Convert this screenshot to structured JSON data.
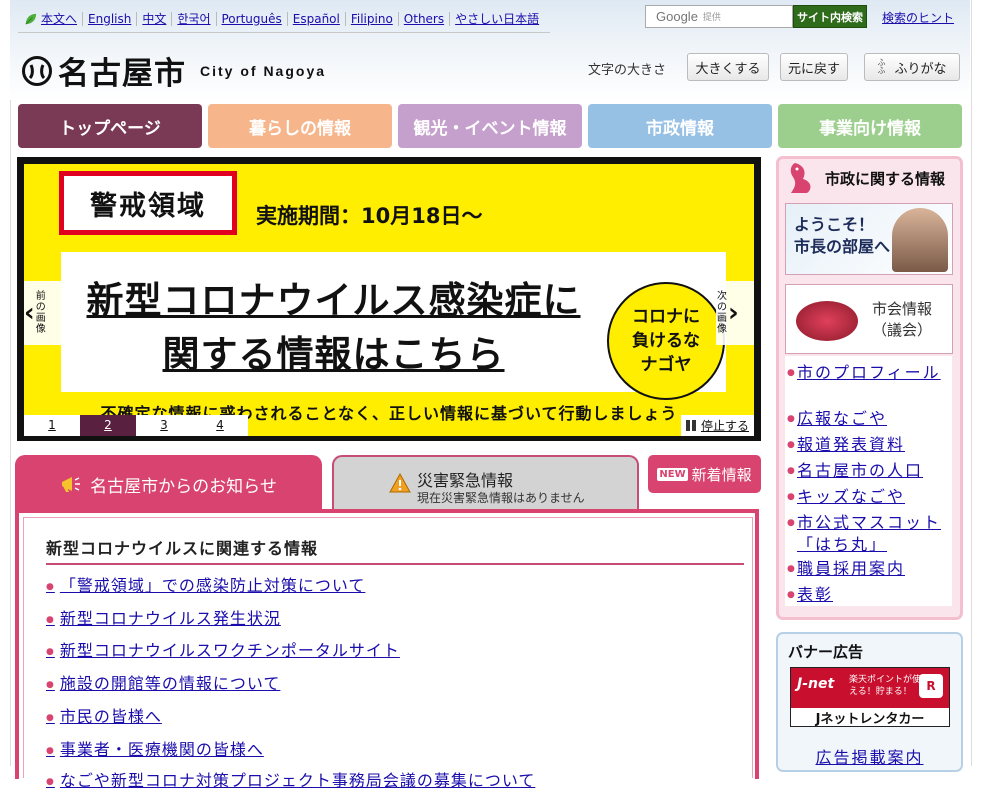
{
  "header": {
    "lang_links": [
      "本文へ",
      "English",
      "中文",
      "한국어",
      "Português",
      "Español",
      "Filipino",
      "Others",
      "やさしい日本語"
    ],
    "search": {
      "brand": "Google",
      "provided": "提供",
      "button_label": "サイト内検索",
      "hint_label": "検索のヒント"
    },
    "logo": {
      "name": "名古屋市",
      "sub": "City of Nagoya"
    },
    "text_size": {
      "label": "文字の大きさ",
      "larger": "大きくする",
      "reset": "元に戻す"
    },
    "furigana": {
      "ruby": "ふりがな"
    }
  },
  "nav": {
    "items": [
      {
        "label": "トップページ",
        "color": "#7a3a55"
      },
      {
        "label": "暮らしの情報",
        "color": "#f6b58a"
      },
      {
        "label": "観光・イベント情報",
        "color": "#c6a0cc"
      },
      {
        "label": "市政情報",
        "color": "#97c0e5"
      },
      {
        "label": "事業向け情報",
        "color": "#9ccf8e"
      }
    ]
  },
  "slideshow": {
    "badge": "警戒領域",
    "period": "実施期間：10月18日～",
    "headline_1": "新型コロナウイルス感染症に",
    "headline_2": "関する情報はこちら",
    "circle_text": "コロナに\n負けるな\nナゴヤ",
    "bottom_text": "不確定な情報に惑わされることなく、正しい情報に基づいて行動しましょう",
    "prev_label": "前の画像",
    "next_label": "次の画像",
    "pages": [
      "1",
      "2",
      "3",
      "4"
    ],
    "current_page": "2",
    "stop_label": "停止する"
  },
  "tabs": {
    "notice": "名古屋市からのお知らせ",
    "disaster_title": "災害緊急情報",
    "disaster_status": "現在災害緊急情報はありません",
    "new_badge": "NEW",
    "new_label": "新着情報"
  },
  "notices": {
    "title": "新型コロナウイルスに関連する情報",
    "items": [
      "「警戒領域」での感染防止対策について",
      "新型コロナウイルス発生状況",
      "新型コロナウイルスワクチンポータルサイト",
      "施設の開館等の情報について",
      "市民の皆様へ",
      "事業者・医療機関の皆様へ",
      "なごや新型コロナ対策プロジェクト事務局会議の募集について"
    ]
  },
  "sidebar": {
    "title": "市政に関する情報",
    "banner_mayor_1": "ようこそ！",
    "banner_mayor_2": "市長の部屋へ",
    "banner_council_1": "市会情報",
    "banner_council_2": "（議会）",
    "items": [
      "市のプロフィール",
      "広報なごや",
      "報道発表資料",
      "名古屋市の人口",
      "キッズなごや",
      "市公式マスコット「はち丸」",
      "職員採用案内",
      "表彰"
    ],
    "ads_title": "バナー広告",
    "ad_jnet_brand": "J-net",
    "ad_jnet_msg": "楽天ポイントが使える！貯まる！",
    "ad_jnet_name": "Jネットレンタカー",
    "ad_info": "広告掲載案内"
  }
}
